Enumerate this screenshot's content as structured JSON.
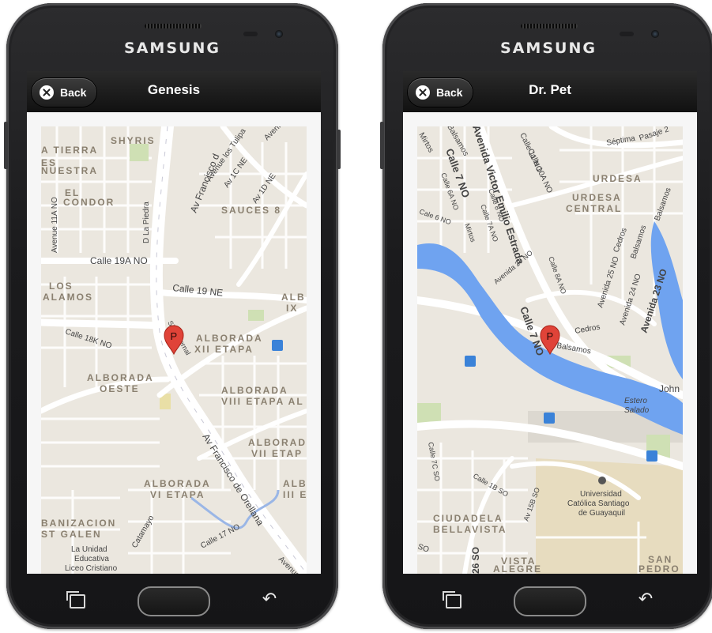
{
  "phones": [
    {
      "brand": "SAMSUNG",
      "back_label": "Back",
      "title": "Genesis",
      "marker_label": "P",
      "map_labels": {
        "shyris": "SHYRIS",
        "tierra": "A TIERRA",
        "es_nuestra": "ES\nNUESTRA",
        "el_condor": "EL\nCONDOR",
        "av_francisco": "Av Francisco d",
        "avenue_tulipanes": "Avenue los Tulipa",
        "av_1c_ne": "Av 1C NE",
        "av_1d_ne": "Av 1D NE",
        "avenida": "Avenid",
        "sauces_8": "SAUCES 8",
        "avenue_11a": "Avenue 11A NO",
        "d_la_piedra": "D La Piedra",
        "calle_19a_no": "Calle 19A NO",
        "calle_19_ne": "Calle 19 NE",
        "los_alamos": "LOS\nALAMOS",
        "alb_ix": "ALB\nIX",
        "calle_18k": "Calle 18K NO",
        "sixto_bernal": "Sixto Bernal",
        "alborada_xii": "ALBORADA\nXII ETAPA",
        "alborada_oeste": "ALBORADA\nOESTE",
        "alborada_viii": "ALBORADA\nVIII ETAPA AL",
        "alborada_vii": "ALBORADA\nVII ETAP",
        "av_francisco_orellana": "Av Francisco de Orellana",
        "alborada_vi": "ALBORADA\nVI ETAPA",
        "alb_iii": "ALB\nIII E",
        "banizacion": "BANIZACION\nST GALEN",
        "catamayo": "Catamayo",
        "calle_17_no": "Calle 17 NO",
        "unidad_educativa": "La Unidad\nEducativa\nLiceo Cristiano",
        "avenue_end": "Avenue"
      }
    },
    {
      "brand": "SAMSUNG",
      "back_label": "Back",
      "title": "Dr. Pet",
      "marker_label": "P",
      "map_labels": {
        "mirtos": "Mirtos",
        "balsamos_top": "Balsamos",
        "avenida_victor": "Avenida Victor Emilio Estrada",
        "calle_11_no": "Calle 11 NO",
        "calle_10a_no": "Calle 10A NO",
        "septima": "Séptima",
        "pasaje": "Pasaje 2",
        "urdesa": "URDESA",
        "urdesa_central": "URDESA\nCENTRAL",
        "calle_7_no_top": "Calle 7 NO",
        "calle_6a_no": "Calle 6A NO",
        "calle_8_no": "Calle 8 NO",
        "calle_7a_no": "Calle 7A NO",
        "cale_6_no": "Cale 6 NO",
        "mirtos_2": "Mirtos",
        "cedros_top": "Cedros",
        "balsamos_right": "Balsamos",
        "avenida_27": "Avenida 27 NO",
        "calle_8a": "Calle 8A NO",
        "avenida_25": "Avenida 25 NO",
        "balsamos_mid": "Balsamos",
        "avenida_24": "Avenida 24 NO",
        "avenida_23": "Avenida 23 NO",
        "calle_7_no_mid": "Calle 7 NO",
        "cedros_mid": "Cedros",
        "balsamos_low": "Balsamos",
        "john": "John",
        "estero_salado": "Estero\nSalado",
        "calle_7c_so": "Calle 7C SO",
        "calle_1b_so": "Calle 1B SO",
        "av_15b_so": "Av 15B SO",
        "universidad": "Universidad\nCatólica Santiago\nde Guayaquil",
        "ciudadela": "CIUDADELA\nBELLAVISTA",
        "so": "SO",
        "so_26": "26 SO",
        "vista_alegre": "VISTA\nALEGRE",
        "san_pedro": "SAN\nPEDRO"
      }
    }
  ]
}
